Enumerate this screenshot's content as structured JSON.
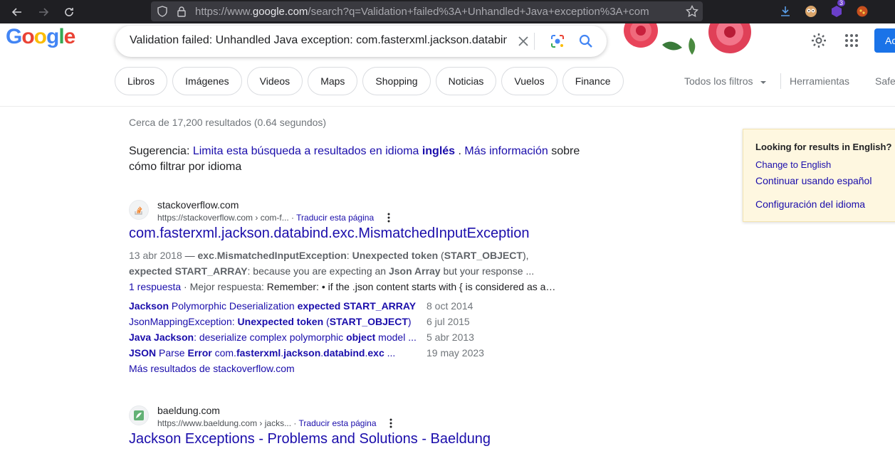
{
  "browser": {
    "url_prefix": "https://www.",
    "url_domain": "google.com",
    "url_rest": "/search?q=Validation+failed%3A+Unhandled+Java+exception%3A+com",
    "extension_badge": "3"
  },
  "search": {
    "query": "Validation failed: Unhandled Java exception: com.fasterxml.jackson.databind"
  },
  "chips": [
    "Libros",
    "Imágenes",
    "Videos",
    "Maps",
    "Shopping",
    "Noticias",
    "Vuelos",
    "Finance"
  ],
  "tools": {
    "all_filters": "Todos los filtros",
    "tools": "Herramientas",
    "safe": "Safe"
  },
  "header": {
    "signin": "Ac"
  },
  "stats": "Cerca de 17,200 resultados (0.64 segundos)",
  "suggestion": {
    "prefix": "Sugerencia:",
    "link": "Limita esta búsqueda a resultados en idioma",
    "lang": "inglés",
    "more": "Más información",
    "rest": "sobre cómo filtrar por idioma"
  },
  "results": [
    {
      "site": "stackoverflow.com",
      "cite": "https://stackoverflow.com › com-f...",
      "translate": "Traducir esta página",
      "title": "com.fasterxml.jackson.databind.exc.MismatchedInputException",
      "date": "13 abr 2018",
      "snippet1_a": "exc",
      "snippet1_b": "MismatchedInputException",
      "snippet1_c": "Unexpected token",
      "snippet1_d": "START_OBJECT",
      "snippet2_a": "expected START_ARRAY",
      "snippet2_b": ": because you are expecting an ",
      "snippet2_c": "Json Array",
      "snippet2_d": " but your response ...",
      "answers": "1 respuesta",
      "best": "Mejor respuesta:",
      "best_text": "Remember: • if the .json content starts with { is considered as a…",
      "more": "Más resultados de stackoverflow.com",
      "sublinks": [
        {
          "parts": [
            [
              "b",
              "Jackson"
            ],
            [
              "n",
              " Polymorphic Deserialization "
            ],
            [
              "b",
              "expected START_ARRAY"
            ]
          ],
          "date": "8 oct 2014"
        },
        {
          "parts": [
            [
              "n",
              "JsonMappingException: "
            ],
            [
              "b",
              "Unexpected token"
            ],
            [
              "n",
              " ("
            ],
            [
              "b",
              "START_OBJECT"
            ],
            [
              "n",
              ")"
            ]
          ],
          "date": "6 jul 2015"
        },
        {
          "parts": [
            [
              "b",
              "Java Jackson"
            ],
            [
              "n",
              ": deserialize complex polymorphic "
            ],
            [
              "b",
              "object"
            ],
            [
              "n",
              " model ..."
            ]
          ],
          "date": "5 abr 2013"
        },
        {
          "parts": [
            [
              "b",
              "JSON"
            ],
            [
              "n",
              " Parse "
            ],
            [
              "b",
              "Error"
            ],
            [
              "n",
              " com."
            ],
            [
              "b",
              "fasterxml"
            ],
            [
              "n",
              "."
            ],
            [
              "b",
              "jackson"
            ],
            [
              "n",
              "."
            ],
            [
              "b",
              "databind"
            ],
            [
              "n",
              "."
            ],
            [
              "b",
              "exc"
            ],
            [
              "n",
              " ..."
            ]
          ],
          "date": "19 may 2023"
        }
      ]
    },
    {
      "site": "baeldung.com",
      "cite": "https://www.baeldung.com › jacks...",
      "translate": "Traducir esta página",
      "title": "Jackson Exceptions - Problems and Solutions - Baeldung"
    }
  ],
  "language_panel": {
    "heading": "Looking for results in English?",
    "change": "Change to English",
    "continue": "Continuar usando español",
    "settings": "Configuración del idioma"
  },
  "colors": {
    "link": "#1a0dab",
    "accent": "#1a73e8",
    "panel_bg": "#fef7e0"
  }
}
